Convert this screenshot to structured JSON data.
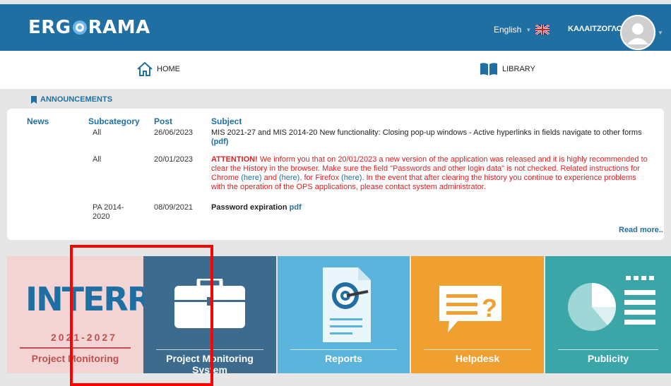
{
  "header": {
    "logo_left": "ERG",
    "logo_right": "RAMA",
    "language": "English",
    "user_name": "ΚΑΛΑΙΤΖΟΓΛΟΥ"
  },
  "nav": {
    "home_label": "HOME",
    "library_label": "LIBRARY"
  },
  "announcements": {
    "title": "ANNOUNCEMENTS",
    "columns": {
      "news": "News",
      "subcategory": "Subcategory",
      "post": "Post",
      "subject": "Subject"
    },
    "rows": [
      {
        "subcategory": "All",
        "post": "26/06/2023",
        "subject": "MIS 2021-27 and MIS 2014-20 New functionality: Closing pop-up windows - Active hyperlinks in fields navigate to other forms",
        "link": "(pdf)"
      },
      {
        "subcategory": "All",
        "post": "20/01/2023",
        "attention": "ATTENTION!",
        "subject_part1": " We inform you that on 20/01/2023 a new version of the application was released and it is highly recommended to clear the History in the browser. Make sure the field \"Passwords and other login data\" is not checked. Related instructions for Chrome ",
        "link1": "(here)",
        "subject_part2": " and ",
        "link2": "(here)",
        "subject_part3": ", for Firefox ",
        "link3": "(here)",
        "subject_part4": ". In the event that after clearing the history you continue to experience problems with the operation of the OPS applications, please contact system administrator."
      },
      {
        "subcategory_line1": "PA 2014-",
        "subcategory_line2": "2020",
        "post": "08/09/2021",
        "subject": "Password expiration",
        "link": "pdf"
      }
    ],
    "read_more": "Read more.."
  },
  "tiles": [
    {
      "logo": "INTERREG",
      "years": "2021-2027",
      "label": "Project Monitoring",
      "color": "#f2d4d4"
    },
    {
      "label_line1": "Project Monitoring",
      "label_line2": "System",
      "color": "#3c6b8e"
    },
    {
      "label": "Reports",
      "color": "#5ab4dc"
    },
    {
      "label": "Helpdesk",
      "color": "#f0a030"
    },
    {
      "label": "Publicity",
      "color": "#3aa6a8"
    }
  ],
  "colors": {
    "brand": "#1f6fa3",
    "attention": "#e02020",
    "highlight_frame": "#ff0000"
  }
}
